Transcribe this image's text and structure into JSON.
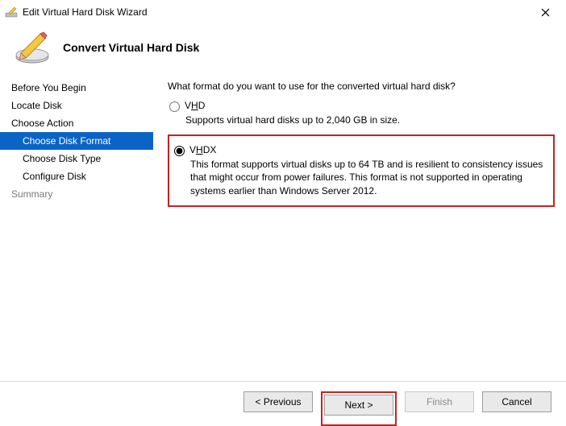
{
  "window": {
    "title": "Edit Virtual Hard Disk Wizard"
  },
  "header": {
    "title": "Convert Virtual Hard Disk"
  },
  "sidebar": {
    "items": [
      {
        "label": "Before You Begin"
      },
      {
        "label": "Locate Disk"
      },
      {
        "label": "Choose Action"
      },
      {
        "label": "Choose Disk Format"
      },
      {
        "label": "Choose Disk Type"
      },
      {
        "label": "Configure Disk"
      },
      {
        "label": "Summary"
      }
    ]
  },
  "content": {
    "prompt": "What format do you want to use for the converted virtual hard disk?",
    "options": {
      "vhd": {
        "prefix": "V",
        "mnemonic": "H",
        "suffix": "D",
        "desc": "Supports virtual hard disks up to 2,040 GB in size."
      },
      "vhdx": {
        "prefix": "V",
        "mnemonic": "H",
        "suffix": "DX",
        "desc": "This format supports virtual disks up to 64 TB and is resilient to consistency issues that might occur from power failures. This format is not supported in operating systems earlier than Windows Server 2012."
      }
    }
  },
  "footer": {
    "previous": "< Previous",
    "next": "Next >",
    "finish": "Finish",
    "cancel": "Cancel"
  }
}
